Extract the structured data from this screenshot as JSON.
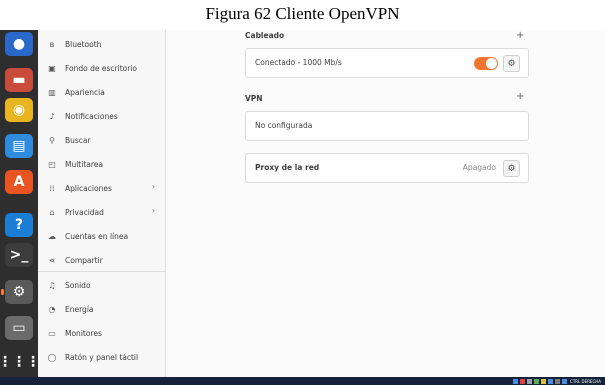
{
  "caption": "Figura 62 Cliente OpenVPN",
  "dock": {
    "items": [
      {
        "name": "thunderbird-icon",
        "glyph": "●",
        "color": "#2a68c9"
      },
      {
        "name": "files-icon",
        "glyph": "▬",
        "color": "#c94b3a"
      },
      {
        "name": "rhythmbox-icon",
        "glyph": "◉",
        "color": "#e8b420"
      },
      {
        "name": "writer-icon",
        "glyph": "▤",
        "color": "#2f8bdd"
      },
      {
        "name": "software-icon",
        "glyph": "A",
        "color": "#e95420"
      },
      {
        "name": "help-icon",
        "glyph": "?",
        "color": "#1a7fd4"
      },
      {
        "name": "terminal-icon",
        "glyph": ">_",
        "color": "#3c3c3c"
      },
      {
        "name": "settings-icon",
        "glyph": "⚙",
        "color": "#5a5a5a"
      },
      {
        "name": "drive-icon",
        "glyph": "▭",
        "color": "#6b6b6b"
      },
      {
        "name": "app-grid-icon",
        "glyph": "⋮⋮⋮",
        "color": "#2e2e2e"
      }
    ]
  },
  "sidebar": {
    "items": [
      {
        "label": "Bluetooth",
        "icon": "bluetooth-icon",
        "glyph": "ʙ"
      },
      {
        "label": "Fondo de escritorio",
        "icon": "background-icon",
        "glyph": "▣"
      },
      {
        "label": "Apariencia",
        "icon": "appearance-icon",
        "glyph": "▥"
      },
      {
        "label": "Notificaciones",
        "icon": "bell-icon",
        "glyph": "♪"
      },
      {
        "label": "Buscar",
        "icon": "search-icon",
        "glyph": "⚲"
      },
      {
        "label": "Multitarea",
        "icon": "multitask-icon",
        "glyph": "◰"
      },
      {
        "label": "Aplicaciones",
        "icon": "apps-icon",
        "glyph": "⁞⁞",
        "chevron": "›"
      },
      {
        "label": "Privacidad",
        "icon": "privacy-icon",
        "glyph": "⌂",
        "chevron": "›"
      },
      {
        "label": "Cuentas en línea",
        "icon": "cloud-icon",
        "glyph": "☁"
      },
      {
        "label": "Compartir",
        "icon": "share-icon",
        "glyph": "⋖"
      },
      {
        "label": "Sonido",
        "icon": "music-icon",
        "glyph": "♫"
      },
      {
        "label": "Energía",
        "icon": "power-icon",
        "glyph": "◔"
      },
      {
        "label": "Monitores",
        "icon": "monitor-icon",
        "glyph": "▭"
      },
      {
        "label": "Ratón y panel táctil",
        "icon": "mouse-icon",
        "glyph": "◯"
      }
    ]
  },
  "wired": {
    "title": "Cableado",
    "add": "+",
    "status": "Conectado - 1000 Mb/s",
    "toggle_on": true
  },
  "vpn": {
    "title": "VPN",
    "add": "+",
    "status": "No configurada"
  },
  "proxy": {
    "label": "Proxy de la red",
    "status": "Apagado"
  },
  "gear_glyph": "⚙",
  "taskbar": {
    "tray_text": "CTRL DERECHA"
  }
}
